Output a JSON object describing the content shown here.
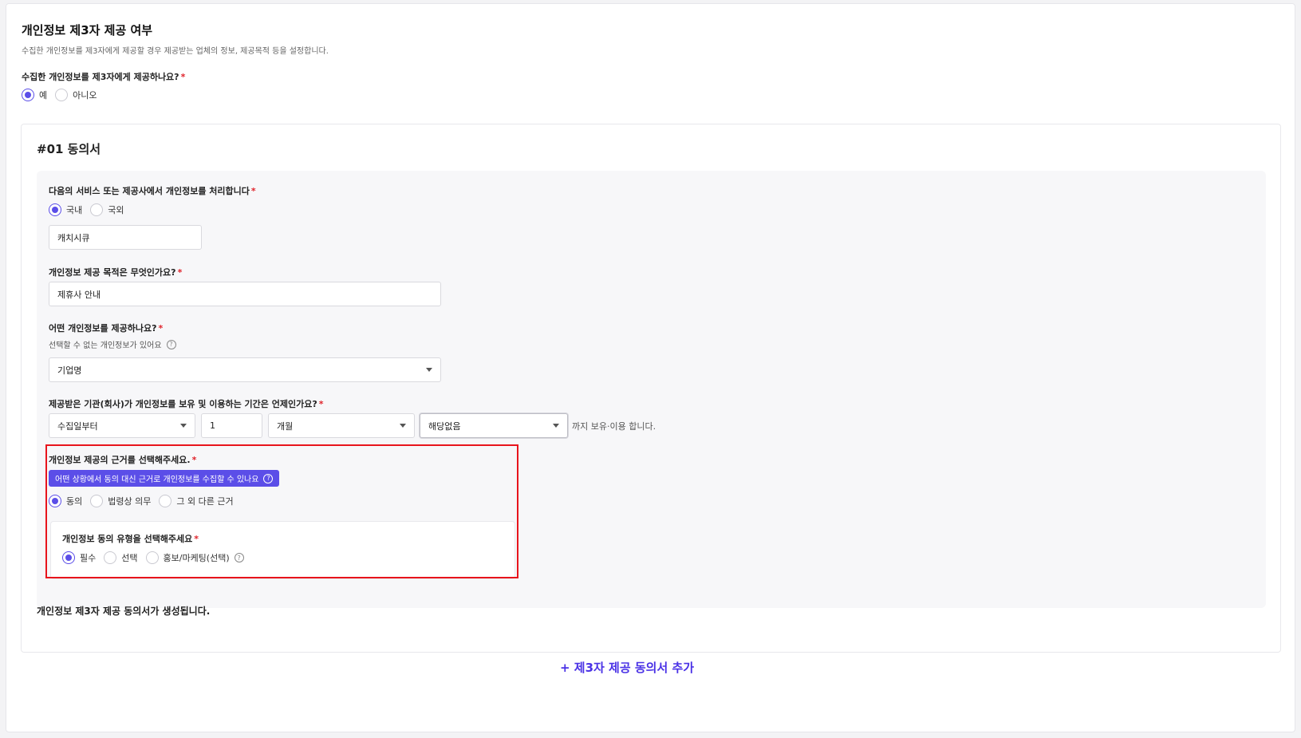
{
  "section": {
    "title": "개인정보 제3자 제공 여부",
    "desc": "수집한 개인정보를 제3자에게 제공할 경우 제공받는 업체의 정보, 제공목적 등을 설정합니다.",
    "question": "수집한 개인정보를 제3자에게 제공하나요?",
    "options": [
      "예",
      "아니오"
    ],
    "selected": "예"
  },
  "card": {
    "title": "#01 동의서",
    "processor": {
      "question": "다음의 서비스 또는 제공사에서 개인정보를 처리합니다",
      "options": [
        "국내",
        "국외"
      ],
      "selected": "국내",
      "value": "캐치시큐"
    },
    "purpose": {
      "question": "개인정보 제공 목적은 무엇인가요?",
      "value": "제휴사 안내"
    },
    "items": {
      "question": "어떤 개인정보를 제공하나요?",
      "hint": "선택할 수 없는 개인정보가 있어요",
      "value": "기업명"
    },
    "period": {
      "question": "제공받은 기관(회사)가 개인정보를 보유 및 이용하는 기간은 언제인가요?",
      "start": "수집일부터",
      "amount": "1",
      "unit": "개월",
      "extra": "해당없음",
      "suffix": "까지 보유·이용 합니다."
    },
    "basis": {
      "question": "개인정보 제공의 근거를 선택해주세요.",
      "badge": "어떤 상황에서 동의 대신 근거로 개인정보를 수집할 수 있나요",
      "options": [
        "동의",
        "법령상 의무",
        "그 외 다른 근거"
      ],
      "selected": "동의",
      "consent_type": {
        "question": "개인정보 동의 유형을 선택해주세요",
        "options": [
          "필수",
          "선택",
          "홍보/마케팅(선택)"
        ],
        "selected": "필수"
      }
    },
    "footer": "개인정보 제3자 제공 동의서가 생성됩니다."
  },
  "add_link": "+ 제3자 제공 동의서 추가",
  "colors": {
    "accent": "#5b4ee8",
    "required": "#e0242c",
    "highlight_box": "#e8141c"
  }
}
